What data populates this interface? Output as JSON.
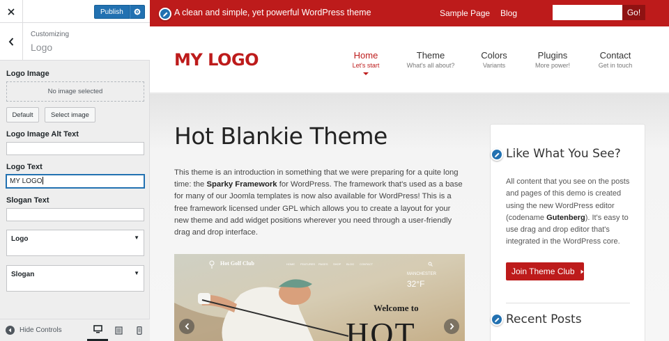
{
  "customizer": {
    "publish_label": "Publish",
    "breadcrumb": "Customizing",
    "section_title": "Logo",
    "logo_image": {
      "label": "Logo Image",
      "placeholder": "No image selected",
      "default_btn": "Default",
      "select_btn": "Select image"
    },
    "logo_alt": {
      "label": "Logo Image Alt Text",
      "value": ""
    },
    "logo_text": {
      "label": "Logo Text",
      "value": "MY LOGO"
    },
    "slogan_text": {
      "label": "Slogan Text",
      "value": ""
    },
    "selects": [
      {
        "label": "Logo"
      },
      {
        "label": "Slogan"
      }
    ],
    "footer": {
      "hide_controls": "Hide Controls"
    }
  },
  "preview": {
    "topbar": {
      "tagline": "A clean and simple, yet powerful WordPress theme",
      "links": [
        "Sample Page",
        "Blog"
      ],
      "search_button": "Go!",
      "search_placeholder": ""
    },
    "logo": "MY LOGO",
    "nav": [
      {
        "label": "Home",
        "sub": "Let's start",
        "active": true
      },
      {
        "label": "Theme",
        "sub": "What's all about?"
      },
      {
        "label": "Colors",
        "sub": "Variants"
      },
      {
        "label": "Plugins",
        "sub": "More power!"
      },
      {
        "label": "Contact",
        "sub": "Get in touch"
      }
    ],
    "post": {
      "title": "Hot Blankie Theme",
      "body_1": "This theme is an introduction in something that we were preparing for a quite long time: the ",
      "body_bold": "Sparky Framework",
      "body_2": " for WordPress. The framework that's used as a base for many of our Joomla templates is now also available for WordPress! This is a free framework licensed under GPL which allows you to create a layout for your new theme and add widget positions wherever you need through a user-friendly drag and drop interface."
    },
    "hero": {
      "brand": "Hot Golf Club",
      "menu": [
        "HOME",
        "FEATURES",
        "PAGES",
        "SHOP",
        "BLOG",
        "CONTACT"
      ],
      "city": "MANCHESTER",
      "temperature": "32°F",
      "welcome": "Welcome to",
      "big": "HOT"
    },
    "sidebar": {
      "widget_title": "Like What You See?",
      "text_1": "All content that you see on the posts and pages of this demo is created using the new WordPress editor (codename ",
      "text_bold": "Gutenberg",
      "text_2": "). It's easy to use drag and drop editor that's integrated in the WordPress core.",
      "button": "Join Theme Club",
      "recent_title": "Recent Posts"
    }
  },
  "colors": {
    "brand_red": "#bd1b1b",
    "wp_blue": "#2271b1"
  }
}
